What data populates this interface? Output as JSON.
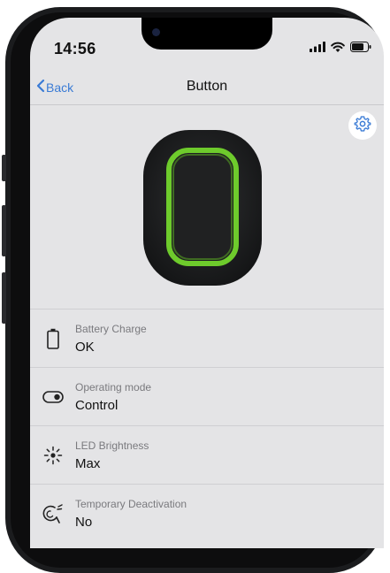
{
  "status_bar": {
    "time": "14:56"
  },
  "nav": {
    "back_label": "Back",
    "title": "Button"
  },
  "settings": {
    "icon": "gear-icon"
  },
  "device": {
    "accent_color": "#6ecb2c",
    "body_color": "#1e1f20"
  },
  "rows": [
    {
      "icon": "battery-icon",
      "label": "Battery Charge",
      "value": "OK"
    },
    {
      "icon": "toggle-icon",
      "label": "Operating mode",
      "value": "Control"
    },
    {
      "icon": "brightness-icon",
      "label": "LED Brightness",
      "value": "Max"
    },
    {
      "icon": "deactivation-icon",
      "label": "Temporary Deactivation",
      "value": "No"
    }
  ]
}
